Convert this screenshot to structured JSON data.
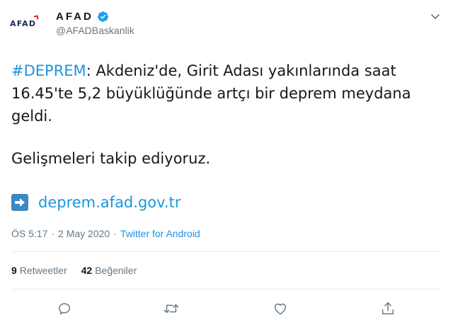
{
  "account": {
    "avatar_text": "AFAD",
    "display_name": "AFAD",
    "handle": "@AFADBaskanlik"
  },
  "tweet": {
    "hashtag": "#DEPREM",
    "line1_rest": ": Akdeniz'de, Girit Adası yakınlarında saat",
    "line2": "16.45'te 5,2 büyüklüğünde artçı bir deprem meydana",
    "line3": "geldi.",
    "line4": "Gelişmeleri takip ediyoruz.",
    "link": "deprem.afad.gov.tr"
  },
  "meta": {
    "time": "ÖS 5:17",
    "separator1": "·",
    "date": "2 May 2020",
    "separator2": "·",
    "source": "Twitter for Android"
  },
  "stats": {
    "retweets_count": "9",
    "retweets_label": "Retweetler",
    "likes_count": "42",
    "likes_label": "Beğeniler"
  },
  "colors": {
    "link": "#1b95e0",
    "secondary_text": "#657786",
    "primary_text": "#14171a",
    "verified": "#1da1f2"
  },
  "icons": {
    "menu": "chevron-down-icon",
    "verified": "verified-badge-icon",
    "link_prefix": "right-arrow-icon",
    "reply": "reply-icon",
    "retweet": "retweet-icon",
    "like": "heart-icon",
    "share": "share-icon"
  }
}
